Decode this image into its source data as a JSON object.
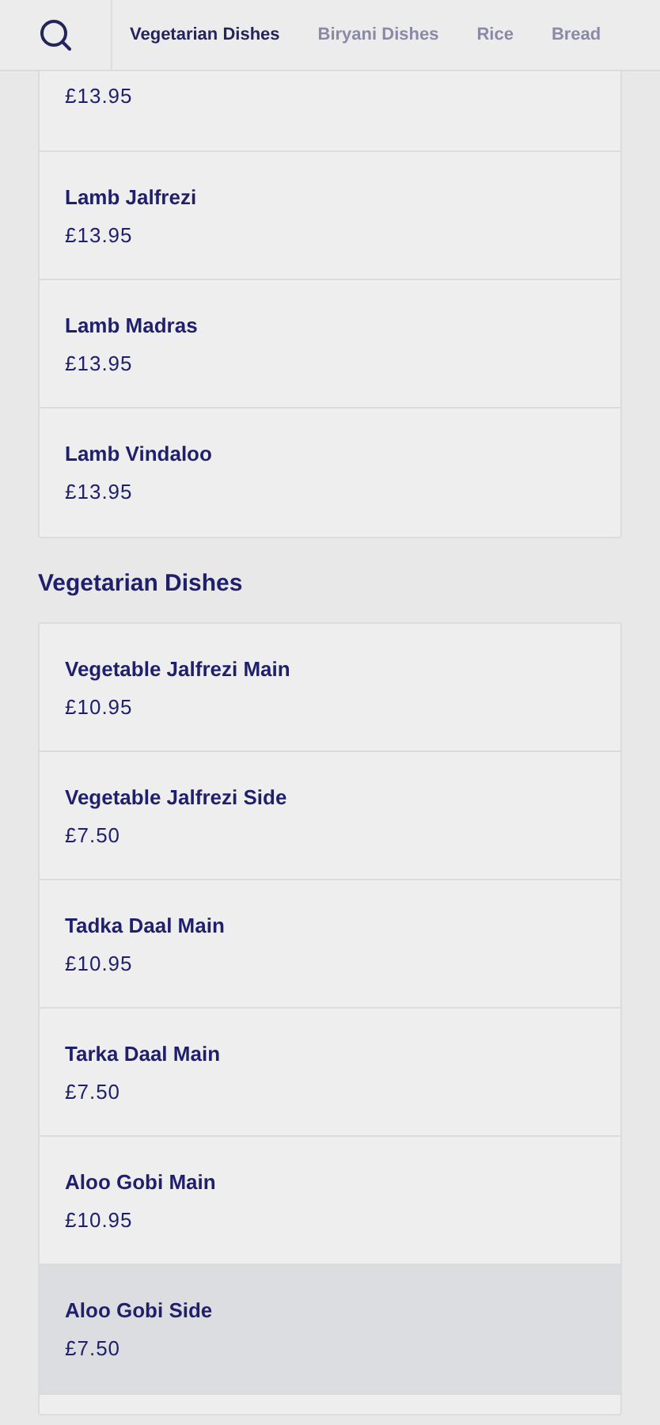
{
  "tabs": [
    {
      "label": "Vegetarian Dishes",
      "selected": true
    },
    {
      "label": "Biryani Dishes",
      "selected": false
    },
    {
      "label": "Rice",
      "selected": false
    },
    {
      "label": "Bread",
      "selected": false
    }
  ],
  "sections": [
    {
      "items": [
        {
          "price": "£13.95",
          "selected": false
        },
        {
          "name": "Lamb Jalfrezi",
          "price": "£13.95",
          "selected": false
        },
        {
          "name": "Lamb Madras",
          "price": "£13.95",
          "selected": false
        },
        {
          "name": "Lamb Vindaloo",
          "price": "£13.95",
          "selected": false
        }
      ]
    },
    {
      "title": "Vegetarian Dishes",
      "items": [
        {
          "name": "Vegetable Jalfrezi Main",
          "price": "£10.95",
          "selected": false
        },
        {
          "name": "Vegetable Jalfrezi Side",
          "price": "£7.50",
          "selected": false
        },
        {
          "name": "Tadka Daal Main",
          "price": "£10.95",
          "selected": false
        },
        {
          "name": "Tarka Daal Main",
          "price": "£7.50",
          "selected": false
        },
        {
          "name": "Aloo Gobi Main",
          "price": "£10.95",
          "selected": false
        },
        {
          "name": "Aloo Gobi Side",
          "price": "£7.50",
          "selected": true
        }
      ]
    }
  ]
}
